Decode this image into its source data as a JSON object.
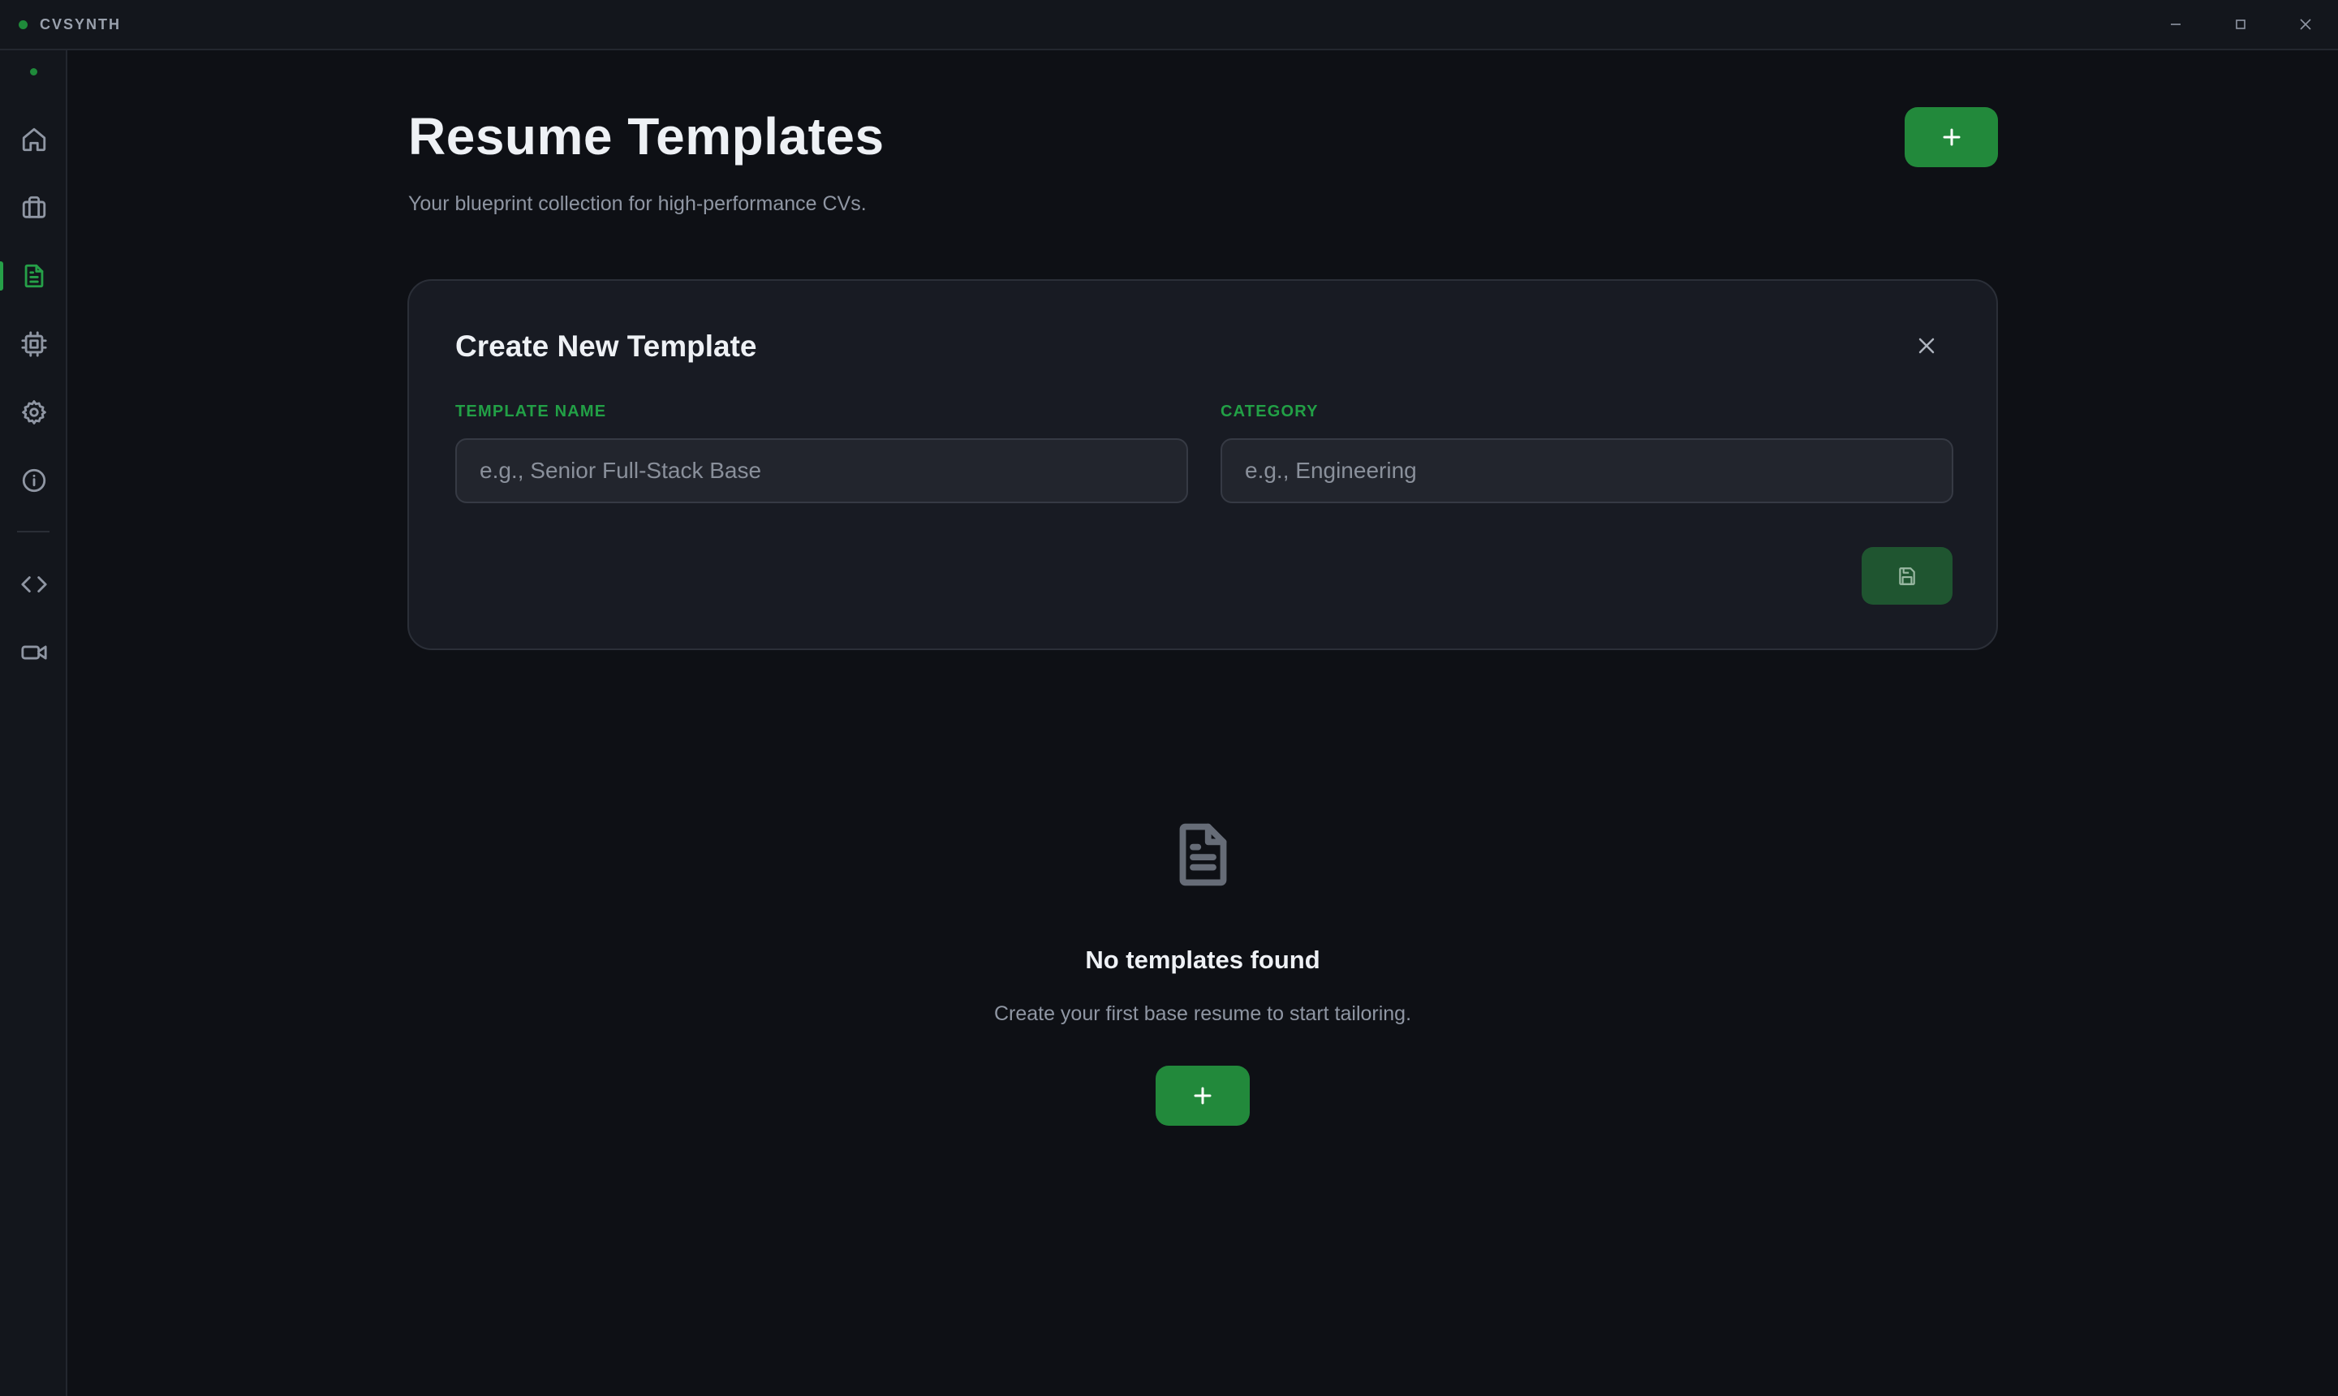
{
  "app": {
    "name": "CVSYNTH"
  },
  "window_controls": [
    "minimize-icon",
    "maximize-icon",
    "close-icon"
  ],
  "sidebar": {
    "items": [
      {
        "id": "home",
        "icon": "home-icon",
        "active": false
      },
      {
        "id": "jobs",
        "icon": "briefcase-icon",
        "active": false
      },
      {
        "id": "templates",
        "icon": "document-icon",
        "active": true
      },
      {
        "id": "models",
        "icon": "cpu-icon",
        "active": false
      },
      {
        "id": "settings",
        "icon": "gear-icon",
        "active": false
      },
      {
        "id": "about",
        "icon": "info-icon",
        "active": false
      },
      {
        "id": "developer",
        "icon": "code-icon",
        "active": false
      },
      {
        "id": "video",
        "icon": "video-icon",
        "active": false
      }
    ]
  },
  "header": {
    "title": "Resume Templates",
    "subtitle": "Your blueprint collection for high-performance CVs.",
    "add_button_icon": "plus-icon"
  },
  "create_form": {
    "title": "Create New Template",
    "close_icon": "close-icon",
    "name_label": "TEMPLATE NAME",
    "name_value": "",
    "name_placeholder": "e.g., Senior Full-Stack Base",
    "category_label": "CATEGORY",
    "category_value": "",
    "category_placeholder": "e.g., Engineering",
    "save_icon": "save-icon"
  },
  "empty_state": {
    "icon": "document-icon",
    "title": "No templates found",
    "description": "Create your first base resume to start tailoring.",
    "button_icon": "plus-icon"
  },
  "colors": {
    "accent": "#22893b",
    "accent_text": "#22a046",
    "background": "#0e1015",
    "card": "#181b23",
    "sidebar": "#13161c"
  }
}
